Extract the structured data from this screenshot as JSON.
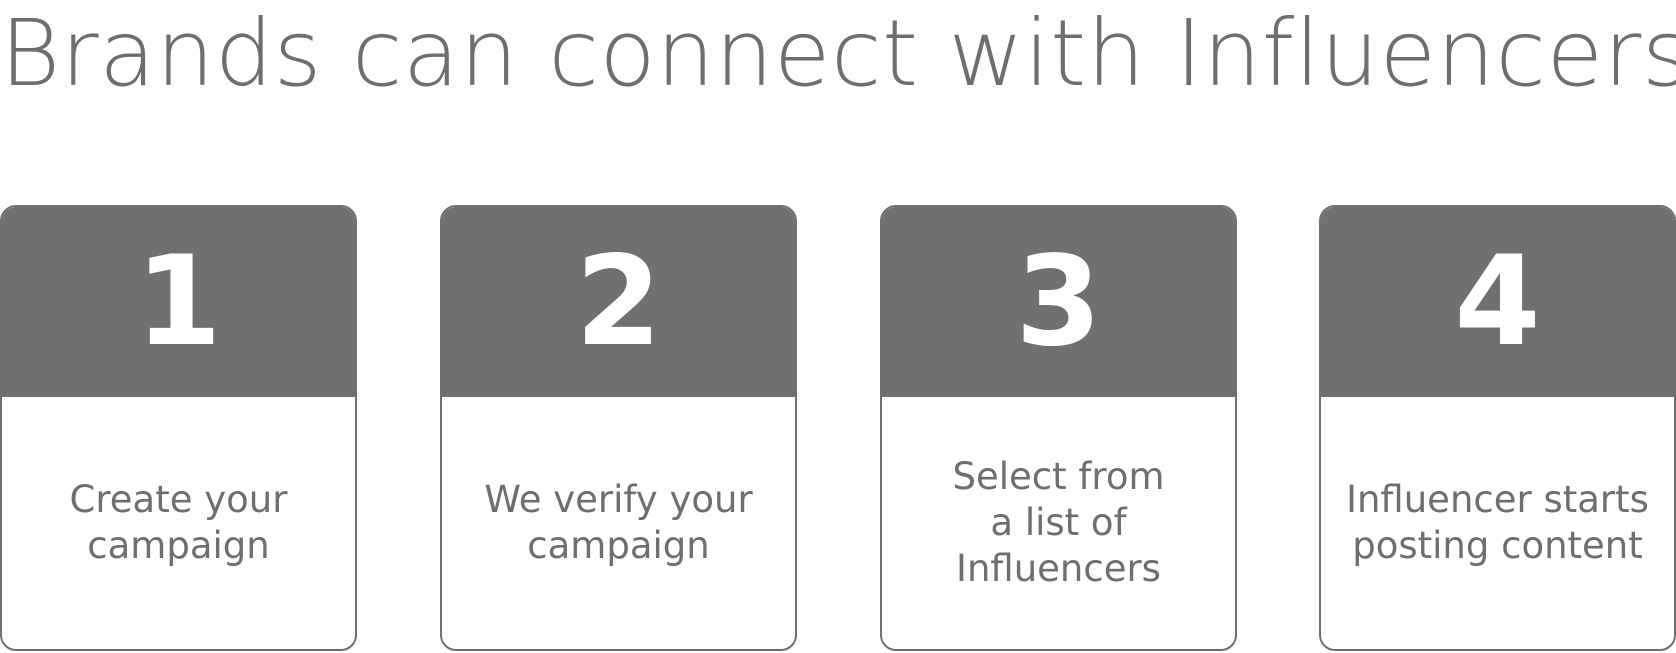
{
  "title": "Brands can connect with Influencers",
  "steps": [
    {
      "number": "1",
      "text": "Create your campaign"
    },
    {
      "number": "2",
      "text": "We verify your campaign"
    },
    {
      "number": "3",
      "text": "Select from a list of Influencers"
    },
    {
      "number": "4",
      "text": "Influencer starts posting content"
    }
  ],
  "colors": {
    "header": "#707070",
    "text": "#6e6e6e",
    "border": "#6f6f6f"
  }
}
